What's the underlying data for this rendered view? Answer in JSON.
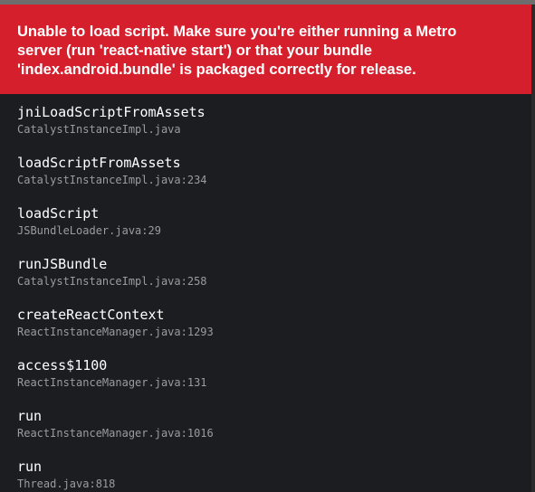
{
  "error": {
    "message": "Unable to load script. Make sure you're either running a Metro server (run 'react-native start') or that your bundle 'index.android.bundle' is packaged correctly for release."
  },
  "stack": [
    {
      "method": "jniLoadScriptFromAssets",
      "file": "CatalystInstanceImpl.java"
    },
    {
      "method": "loadScriptFromAssets",
      "file": "CatalystInstanceImpl.java:234"
    },
    {
      "method": "loadScript",
      "file": "JSBundleLoader.java:29"
    },
    {
      "method": "runJSBundle",
      "file": "CatalystInstanceImpl.java:258"
    },
    {
      "method": "createReactContext",
      "file": "ReactInstanceManager.java:1293"
    },
    {
      "method": "access$1100",
      "file": "ReactInstanceManager.java:131"
    },
    {
      "method": "run",
      "file": "ReactInstanceManager.java:1016"
    },
    {
      "method": "run",
      "file": "Thread.java:818"
    }
  ],
  "colors": {
    "header_background": "#d61f2c",
    "panel_background": "#1b1d21",
    "method_text": "#ffffff",
    "file_text": "#9a9ca2"
  }
}
